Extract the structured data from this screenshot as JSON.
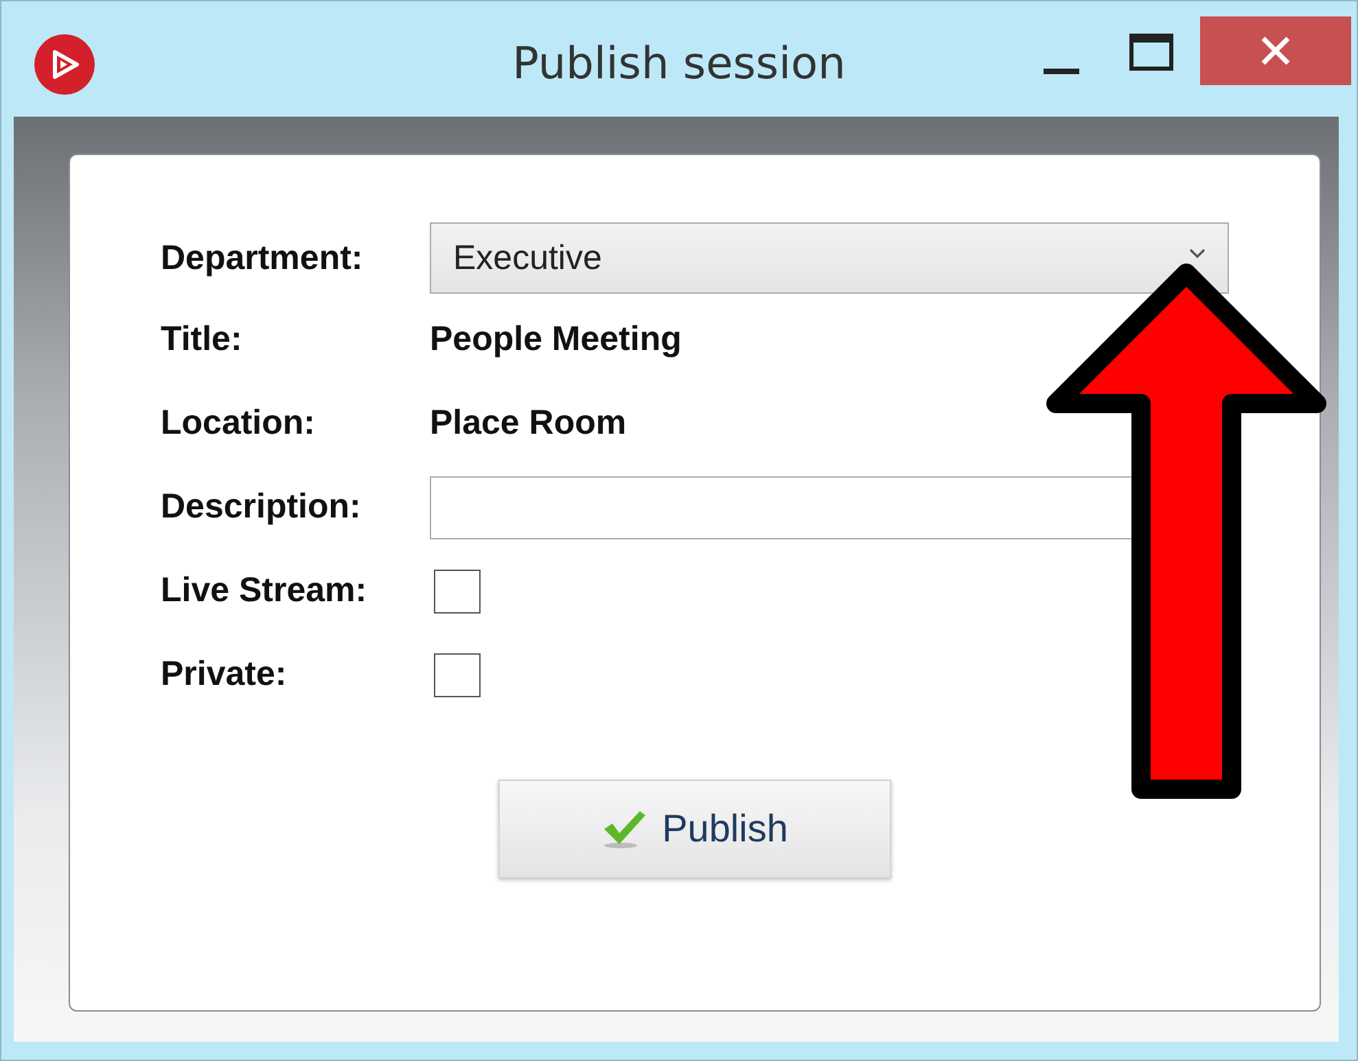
{
  "window": {
    "title": "Publish session"
  },
  "form": {
    "rows": [
      {
        "kind": "dropdown",
        "label": "Department:",
        "value": "Executive"
      },
      {
        "kind": "text",
        "label": "Title:",
        "value": "People Meeting"
      },
      {
        "kind": "text",
        "label": "Location:",
        "value": "Place Room"
      },
      {
        "kind": "input",
        "label": "Description:"
      },
      {
        "kind": "checkbox",
        "label": "Live Stream:",
        "checked": false
      },
      {
        "kind": "checkbox",
        "label": "Private:",
        "checked": false
      }
    ]
  },
  "button": {
    "label": "Publish"
  }
}
